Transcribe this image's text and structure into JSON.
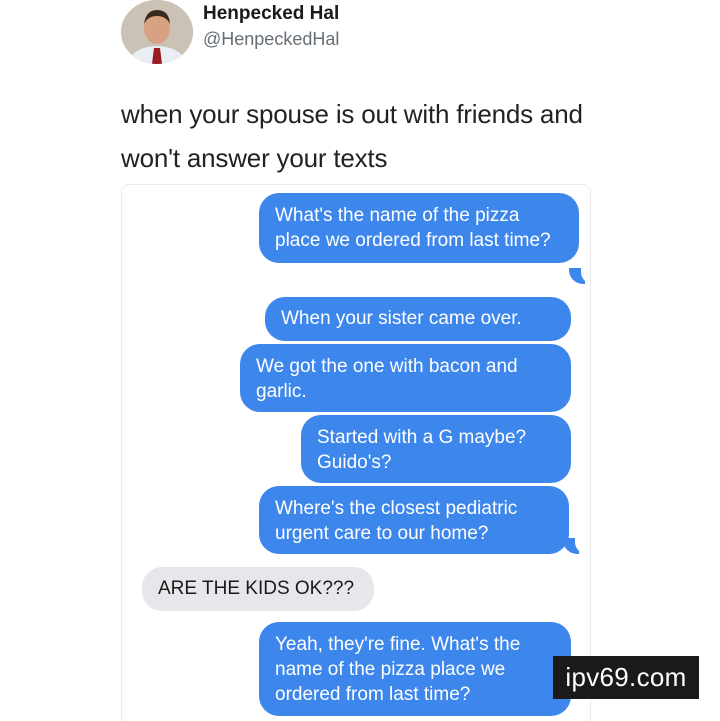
{
  "tweet": {
    "author_name": "Henpecked Hal",
    "author_handle": "@HenpeckedHal",
    "text": "when your spouse is out with friends and won't answer your texts"
  },
  "conversation": {
    "messages": [
      {
        "sender": "me",
        "text": "What's the name of the pizza place we ordered from last time?"
      },
      {
        "sender": "me",
        "text": "When your sister came over."
      },
      {
        "sender": "me",
        "text": "We got the one with bacon and garlic."
      },
      {
        "sender": "me",
        "text": "Started with a G maybe? Guido's?"
      },
      {
        "sender": "me",
        "text": "Where's the closest pediatric urgent care to our home?"
      },
      {
        "sender": "them",
        "text": "ARE THE KIDS OK???"
      },
      {
        "sender": "me",
        "text": "Yeah, they're fine. What's the name of the pizza place we ordered from last time?"
      }
    ]
  },
  "watermark": "ipv69.com",
  "colors": {
    "sent_bubble": "#3d86ec",
    "received_bubble": "#e6e6eb"
  }
}
